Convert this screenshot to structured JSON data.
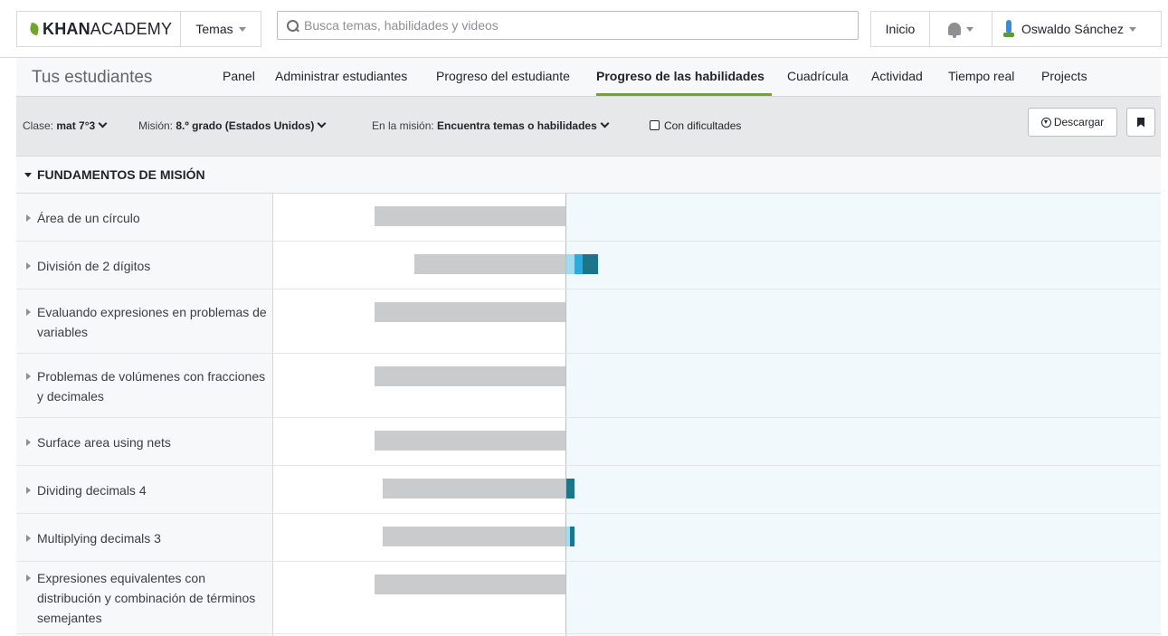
{
  "header": {
    "logo": {
      "bold": "KHAN",
      "light": "ACADEMY"
    },
    "topics_label": "Temas",
    "search_placeholder": "Busca temas, habilidades y videos",
    "home_label": "Inicio",
    "user_name": "Oswaldo Sánchez"
  },
  "subnav": {
    "title": "Tus estudiantes",
    "tabs": [
      {
        "label": "Panel"
      },
      {
        "label": "Administrar estudiantes"
      },
      {
        "label": "Progreso del estudiante"
      },
      {
        "label": "Progreso de las habilidades",
        "active": true
      },
      {
        "label": "Cuadrícula"
      },
      {
        "label": "Actividad"
      },
      {
        "label": "Tiempo real"
      },
      {
        "label": "Projects"
      }
    ]
  },
  "filters": {
    "class_label": "Clase:",
    "class_value": "mat 7°3",
    "mission_label": "Misión:",
    "mission_value": "8.º grado (Estados Unidos)",
    "in_mission_label": "En la misión:",
    "in_mission_value": "Encuentra temas o habilidades",
    "struggling_label": "Con dificultades",
    "download_label": "Descargar"
  },
  "section": {
    "title": "FUNDAMENTOS DE MISIÓN"
  },
  "colors": {
    "gray": "#cacbcd",
    "light": "#9fdcef",
    "medium": "#29abe0",
    "dark": "#1c758a",
    "accent": "#6fa52a"
  },
  "skills": [
    {
      "name": "Área de un círculo",
      "not_started": 24,
      "practiced": 0,
      "level1": 0,
      "level2": 0
    },
    {
      "name": "División de 2 dígitos",
      "not_started": 19,
      "practiced": 1,
      "level1": 1,
      "level2": 2
    },
    {
      "name": "Evaluando expresiones en problemas de variables",
      "not_started": 24,
      "practiced": 0,
      "level1": 0,
      "level2": 0
    },
    {
      "name": "Problemas de volúmenes con fracciones y decimales",
      "not_started": 24,
      "practiced": 0,
      "level1": 0,
      "level2": 0
    },
    {
      "name": "Surface area using nets",
      "not_started": 24,
      "practiced": 0,
      "level1": 0,
      "level2": 0
    },
    {
      "name": "Dividing decimals 4",
      "not_started": 23,
      "practiced": 0,
      "level1": 0,
      "level2": 1
    },
    {
      "name": "Multiplying decimals 3",
      "not_started": 23,
      "practiced": 0.5,
      "level1": 0,
      "level2": 0.5
    },
    {
      "name": "Expresiones equivalentes con distribución y combinación de términos semejantes",
      "not_started": 24,
      "practiced": 0,
      "level1": 0,
      "level2": 0
    }
  ]
}
